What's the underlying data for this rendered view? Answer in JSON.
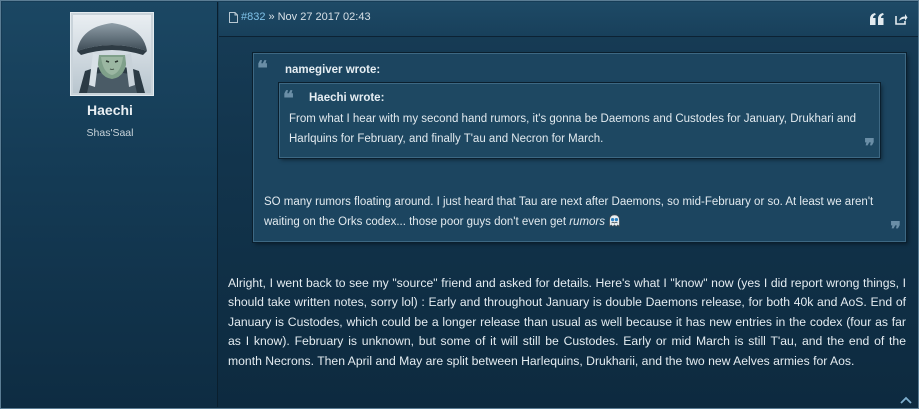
{
  "user": {
    "name": "Haechi",
    "title": "Shas'Saal",
    "avatar_icon": "user-avatar-icon"
  },
  "post_header": {
    "post_number": "#832",
    "separator": "»",
    "date": "Nov 27 2017 02:43",
    "quote_button_icon": "quote-icon",
    "share_button_icon": "share-icon"
  },
  "outer_quote": {
    "author": "namegiver wrote:",
    "text": "SO many rumors floating around. I just heard that Tau are next after Daemons, so mid-February or so. At least we aren't waiting on the Orks codex... those poor guys don't even get ",
    "emphasis": "rumors",
    "smiley_icon": "pacman-ghost-smiley-icon"
  },
  "inner_quote": {
    "author": "Haechi wrote:",
    "text": "From what I hear with my second hand rumors, it's gonna be Daemons and Custodes for January, Drukhari and Harlquins for February, and finally T'au and Necron for March."
  },
  "message": {
    "text": "Alright, I went back to see my \"source\" friend and asked for details. Here's what I \"know\" now (yes I did report wrong things, I should take written notes, sorry lol) : Early and throughout January is double Daemons release, for both 40k and AoS. End of January is Custodes, which could be a longer release than usual as well because it has new entries in the codex (four as far as I know). February is unknown, but some of it will still be Custodes. Early or mid March is still T'au, and the end of the month Necrons. Then April and May are split between Harlequins, Drukharii, and the two new Aelves armies for Aos."
  },
  "colors": {
    "link": "#7fc2e8",
    "text": "#e4ecf1",
    "background": "#12344c"
  }
}
